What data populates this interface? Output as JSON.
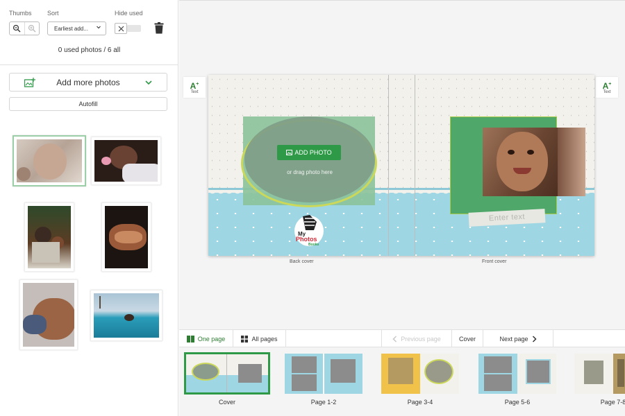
{
  "sidebar": {
    "thumbs_label": "Thumbs",
    "sort_label": "Sort",
    "hide_used_label": "Hide used",
    "sort_value": "Earliest add...",
    "used_count": "0 used photos / 6 all",
    "add_more_label": "Add more photos",
    "autofill_label": "Autofill",
    "photos": [
      "baby-portrait",
      "mother-and-baby",
      "family-at-christmas",
      "holding-hands",
      "baby-hand-in-palm",
      "infinity-pool"
    ]
  },
  "canvas": {
    "text_tool_label": "Text",
    "add_photo_label": "ADD PHOTO",
    "drag_hint": "or drag photo here",
    "banner_text": "Enter text",
    "back_cover_label": "Back cover",
    "front_cover_label": "Front cover",
    "logo_lines": [
      "My",
      "Photos",
      "Books"
    ]
  },
  "toolbar": {
    "one_page": "One page",
    "all_pages": "All pages",
    "previous_page": "Previous page",
    "current": "Cover",
    "next_page": "Next page"
  },
  "pages": [
    {
      "label": "Cover"
    },
    {
      "label": "Page 1-2"
    },
    {
      "label": "Page 3-4"
    },
    {
      "label": "Page 5-6"
    },
    {
      "label": "Page 7-8"
    }
  ],
  "colors": {
    "accent_green": "#2e9a48",
    "sky_blue": "#9fd6e3",
    "slot_green": "#4fa86a"
  }
}
